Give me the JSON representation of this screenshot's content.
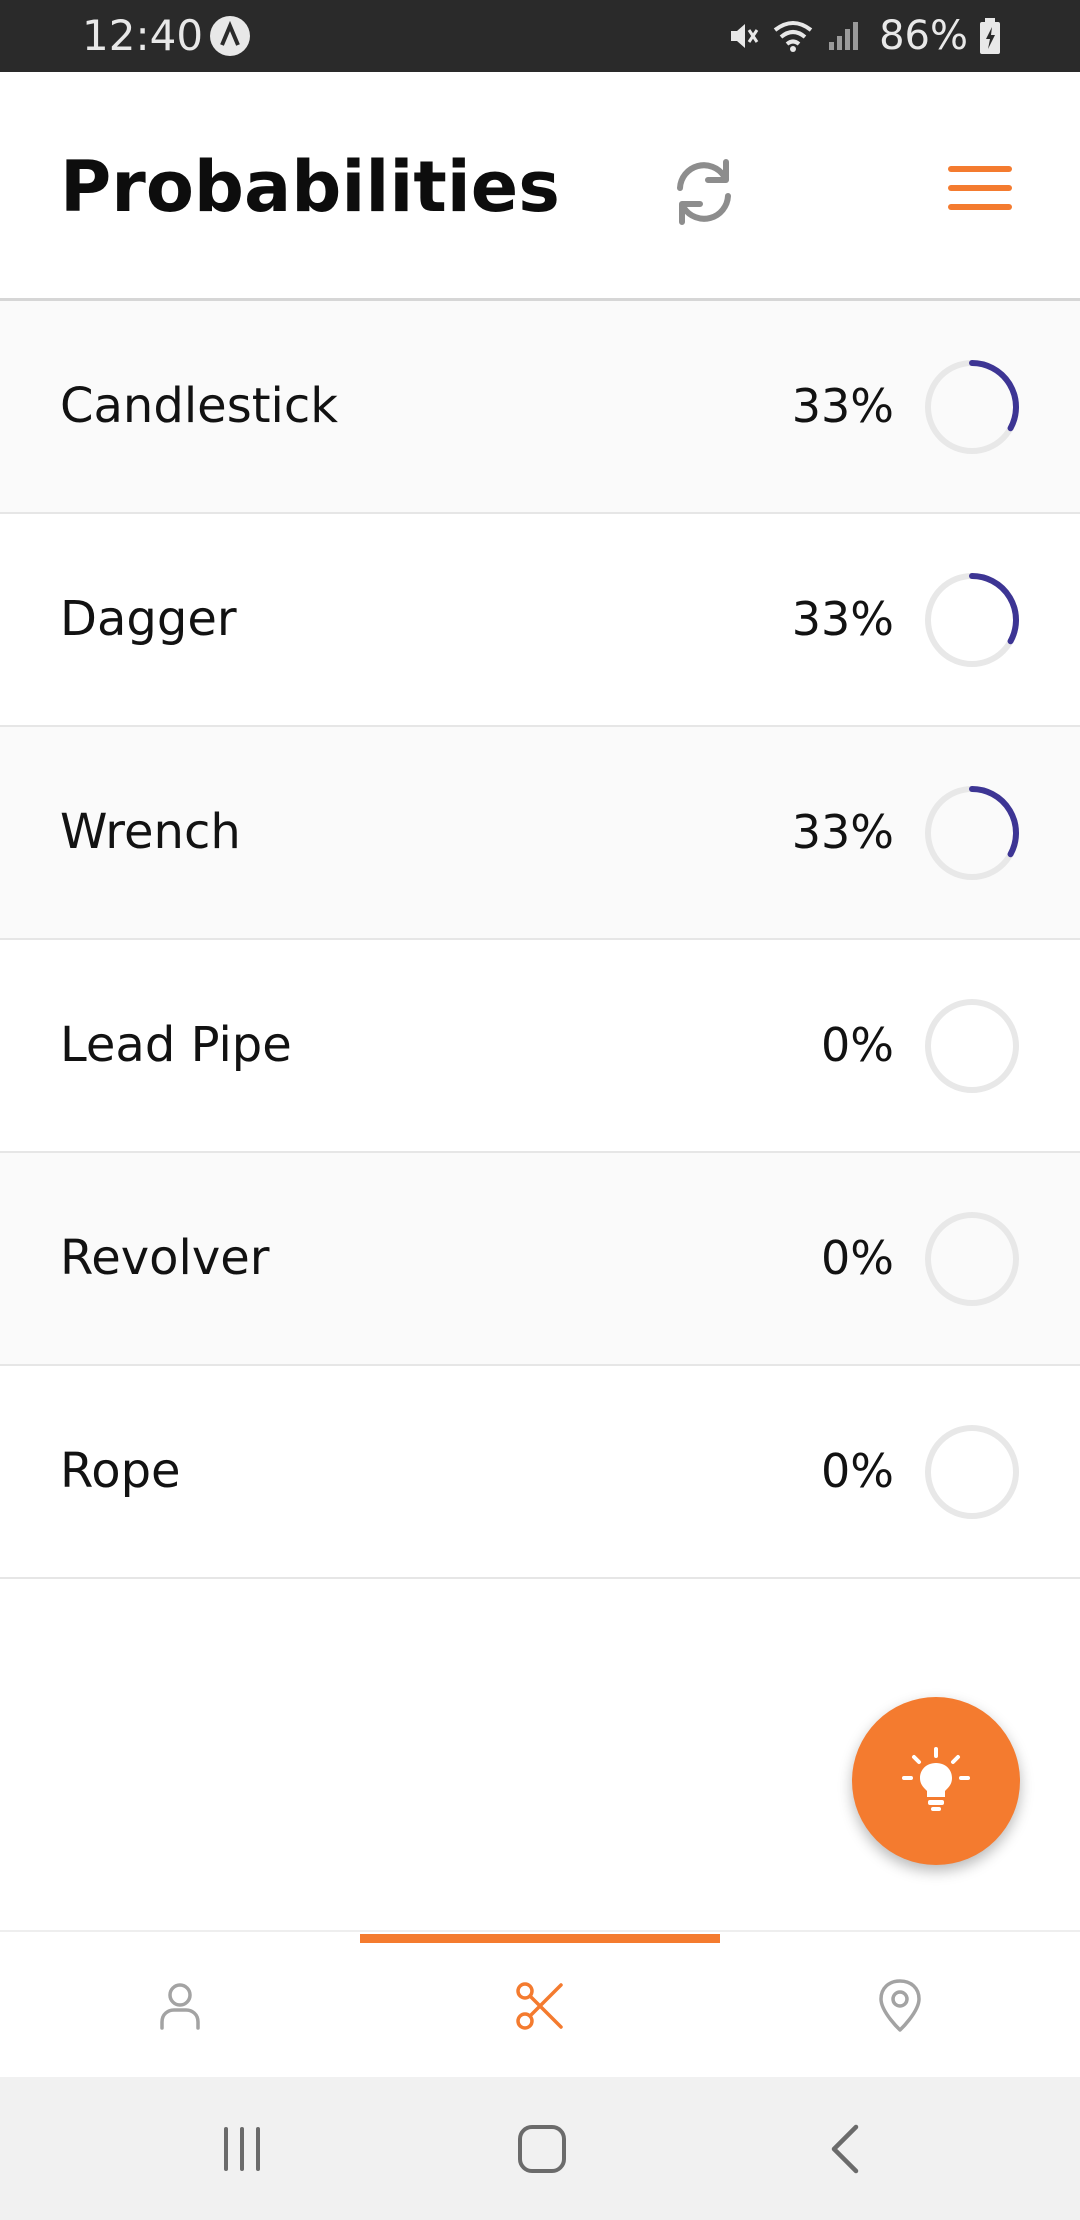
{
  "status_bar": {
    "time": "12:40",
    "battery": "86%",
    "icons": [
      "app-notification-icon",
      "mute-icon",
      "wifi-icon",
      "signal-icon",
      "battery-charging-icon"
    ]
  },
  "header": {
    "title": "Probabilities",
    "icons": [
      "refresh-icon",
      "hamburger-menu-icon"
    ]
  },
  "colors": {
    "accent": "#f47b2f",
    "ring_progress": "#3d3594",
    "ring_track": "#e8e8e8"
  },
  "items": [
    {
      "name": "Candlestick",
      "percent": "33%",
      "value": 0.33
    },
    {
      "name": "Dagger",
      "percent": "33%",
      "value": 0.33
    },
    {
      "name": "Wrench",
      "percent": "33%",
      "value": 0.33
    },
    {
      "name": "Lead Pipe",
      "percent": "0%",
      "value": 0
    },
    {
      "name": "Revolver",
      "percent": "0%",
      "value": 0
    },
    {
      "name": "Rope",
      "percent": "0%",
      "value": 0
    }
  ],
  "fab": {
    "icon": "lightbulb-icon"
  },
  "bottom_nav": {
    "tabs": [
      {
        "icon": "person-icon",
        "active": false
      },
      {
        "icon": "scissors-icon",
        "active": true
      },
      {
        "icon": "location-pin-icon",
        "active": false
      }
    ]
  },
  "system_nav": {
    "buttons": [
      "recent-apps-icon",
      "home-icon",
      "back-icon"
    ]
  }
}
